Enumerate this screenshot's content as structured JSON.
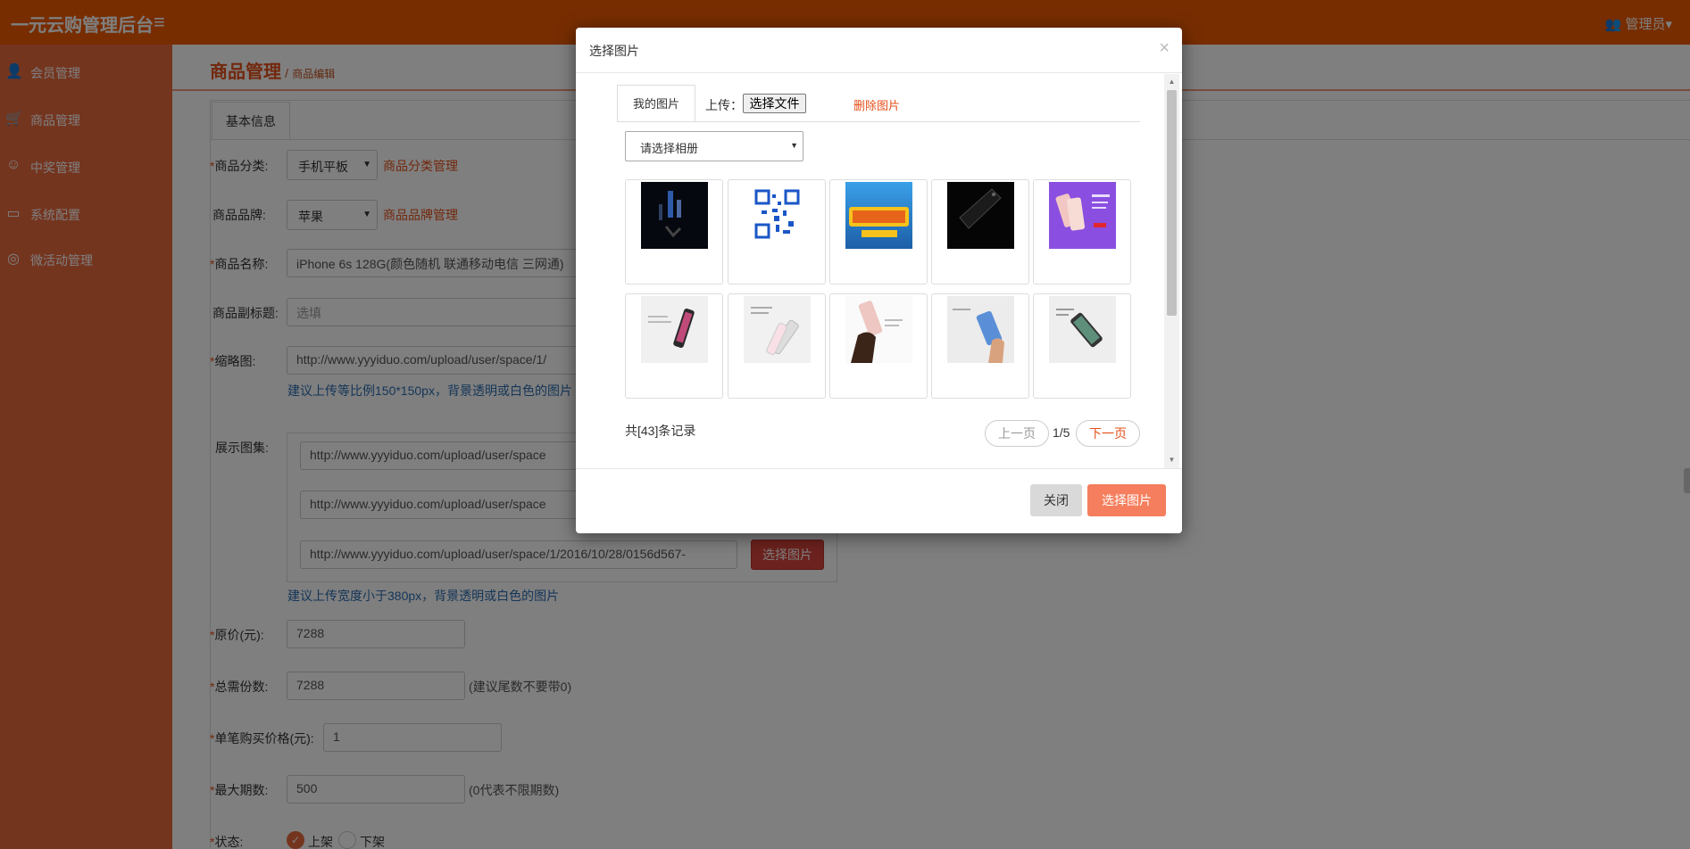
{
  "app": {
    "title": "一元云购管理后台",
    "admin_label": "管理员▾"
  },
  "sidebar": {
    "items": [
      {
        "label": "会员管理",
        "icon": "user-icon"
      },
      {
        "label": "商品管理",
        "icon": "cart-icon"
      },
      {
        "label": "中奖管理",
        "icon": "smile-icon"
      },
      {
        "label": "系统配置",
        "icon": "monitor-icon"
      },
      {
        "label": "微活动管理",
        "icon": "lifebuoy-icon"
      }
    ]
  },
  "breadcrumb": {
    "section": "商品管理",
    "separator": "/",
    "page": "商品编辑"
  },
  "form": {
    "tab_label": "基本信息",
    "category": {
      "label": "商品分类:",
      "value": "手机平板",
      "link": "商品分类管理"
    },
    "brand": {
      "label": "商品品牌:",
      "value": "苹果",
      "link": "商品品牌管理"
    },
    "name": {
      "label": "商品名称:",
      "value": "iPhone 6s 128G(颜色随机 联通移动电信 三网通)"
    },
    "subtitle": {
      "label": "商品副标题:",
      "placeholder": "选填"
    },
    "thumbnail": {
      "label": "缩略图:",
      "value": "http://www.yyyiduo.com/upload/user/space/1/",
      "hint": "建议上传等比例150*150px，背景透明或白色的图片"
    },
    "gallery": {
      "label": "展示图集:",
      "urls": [
        "http://www.yyyiduo.com/upload/user/space",
        "http://www.yyyiduo.com/upload/user/space",
        "http://www.yyyiduo.com/upload/user/space/1/2016/10/28/0156d567-"
      ],
      "pick_button": "选择图片",
      "hint": "建议上传宽度小于380px，背景透明或白色的图片"
    },
    "price": {
      "label": "原价(元):",
      "value": "7288"
    },
    "total_shares": {
      "label": "总需份数:",
      "value": "7288",
      "note": "(建议尾数不要带0)"
    },
    "unit_price": {
      "label": "单笔购买价格(元):",
      "value": "1"
    },
    "max_periods": {
      "label": "最大期数:",
      "value": "500",
      "note": "(0代表不限期数)"
    },
    "status": {
      "label": "状态:",
      "on_label": "上架",
      "off_label": "下架",
      "selected": "上架"
    },
    "required_mark": "*"
  },
  "modal": {
    "title": "选择图片",
    "close_glyph": "×",
    "tab_my": "我的图片",
    "upload_label": "上传：",
    "file_button": "选择文件",
    "delete_link": "删除图片",
    "album_placeholder": "请选择相册",
    "images": [
      {
        "name": "dark-phone-scene-thumbnail"
      },
      {
        "name": "qr-code-thumbnail"
      },
      {
        "name": "presale-banner-thumbnail"
      },
      {
        "name": "black-iphone-thumbnail"
      },
      {
        "name": "pink-iphone-purple-thumbnail"
      },
      {
        "name": "iphone-angle-1-thumbnail"
      },
      {
        "name": "iphone-angle-2-thumbnail"
      },
      {
        "name": "iphone-hand-thumbnail"
      },
      {
        "name": "iphone-hand-2-thumbnail"
      },
      {
        "name": "iphone-flat-thumbnail"
      }
    ],
    "records": "共[43]条记录",
    "prev": "上一页",
    "page": "1/5",
    "next": "下一页",
    "btn_close": "关闭",
    "btn_select": "选择图片"
  },
  "colors": {
    "topbar": "#ee5b00",
    "sidebar": "#e96a3e",
    "accent": "#e5501a",
    "primary_button": "#f47e5d"
  }
}
